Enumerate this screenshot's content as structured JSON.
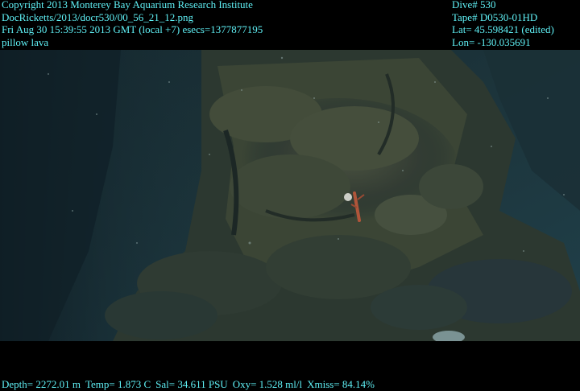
{
  "header_left": {
    "copyright": "Copyright 2013 Monterey Bay Aquarium Research Institute",
    "file_path": "DocRicketts/2013/docr530/00_56_21_12.png",
    "timestamp": "Fri Aug 30 15:39:55 2013 GMT (local +7)  esecs=1377877195",
    "description": "pillow lava"
  },
  "header_right": {
    "dive": "Dive# 530",
    "tape": "Tape# D0530-01HD",
    "lat": "Lat= 45.598421 (edited)",
    "lon": "Lon= -130.035691"
  },
  "footer": {
    "depth": "Depth= 2272.01 m",
    "temp": "Temp= 1.873 C",
    "sal": "Sal= 34.611 PSU",
    "oxy": "Oxy= 1.528 ml/l",
    "xmiss": "Xmiss= 84.14%"
  },
  "colors": {
    "overlay_text": "#5ff0f5",
    "background": "#000000",
    "water": "#17323a",
    "rock": "#3a4436"
  }
}
